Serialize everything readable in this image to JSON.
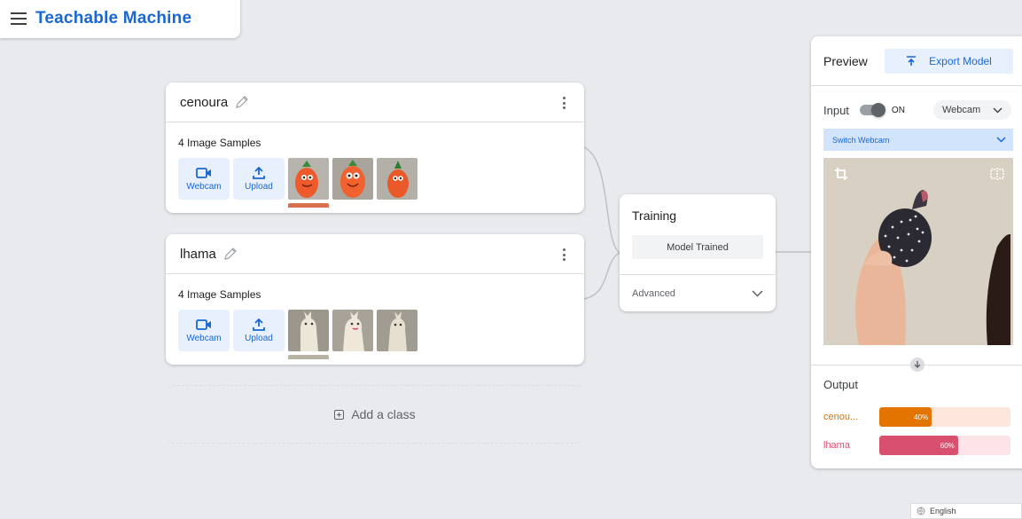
{
  "app": {
    "title": "Teachable Machine"
  },
  "classes": [
    {
      "name": "cenoura",
      "samples_label": "4 Image Samples",
      "webcam_label": "Webcam",
      "upload_label": "Upload",
      "thumb_color": "#e8622c"
    },
    {
      "name": "lhama",
      "samples_label": "4 Image Samples",
      "webcam_label": "Webcam",
      "upload_label": "Upload",
      "thumb_color": "#d8d2c2"
    }
  ],
  "add_class": {
    "label": "Add a class"
  },
  "training": {
    "title": "Training",
    "status_button": "Model Trained",
    "advanced_label": "Advanced"
  },
  "preview": {
    "title": "Preview",
    "export_label": "Export Model",
    "input_label": "Input",
    "toggle_state": "ON",
    "camera_select": "Webcam",
    "switch_webcam_label": "Switch Webcam",
    "output_title": "Output",
    "outputs": [
      {
        "label": "cenou...",
        "percent_label": "40%",
        "value": 0.4,
        "color": "#e37400",
        "track": "#fde7dc"
      },
      {
        "label": "lhama",
        "percent_label": "60%",
        "value": 0.6,
        "color": "#d9506f",
        "track": "#fde4e8"
      }
    ]
  },
  "footer": {
    "language": "English"
  }
}
